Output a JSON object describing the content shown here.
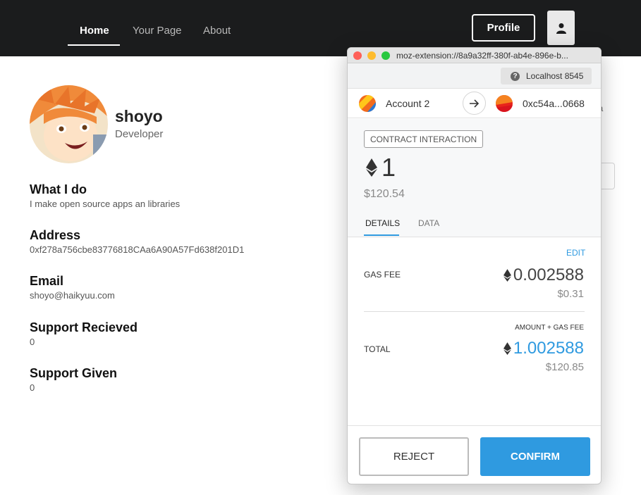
{
  "nav": {
    "items": [
      {
        "label": "Home"
      },
      {
        "label": "Your Page"
      },
      {
        "label": "About"
      }
    ],
    "profile_label": "Profile",
    "user_icon": "user-icon"
  },
  "profile": {
    "name": "shoyo",
    "role": "Developer",
    "sections": [
      {
        "title": "What I do",
        "value": "I make open source apps an libraries"
      },
      {
        "title": "Address",
        "value": "0xf278a756cbe83776818CAa6A90A57Fd638f201D1"
      },
      {
        "title": "Email",
        "value": "shoyo@haikyuu.com"
      },
      {
        "title": "Support Recieved",
        "value": "0"
      },
      {
        "title": "Support Given",
        "value": "0"
      }
    ],
    "background_peek": "a"
  },
  "popup": {
    "url": "moz-extension://8a9a32ff-380f-ab4e-896e-b...",
    "network": "Localhost 8545",
    "from_account": "Account 2",
    "to_account": "0xc54a...0668",
    "badge": "CONTRACT INTERACTION",
    "amount": "1",
    "amount_fiat": "$120.54",
    "tabs": [
      "DETAILS",
      "DATA"
    ],
    "edit_label": "EDIT",
    "gas_fee_label": "GAS FEE",
    "gas_fee_eth": "0.002588",
    "gas_fee_fiat": "$0.31",
    "total_sublabel": "AMOUNT + GAS FEE",
    "total_label": "TOTAL",
    "total_eth": "1.002588",
    "total_fiat": "$120.85",
    "reject_label": "REJECT",
    "confirm_label": "CONFIRM",
    "accent_color": "#2f9ae0"
  }
}
